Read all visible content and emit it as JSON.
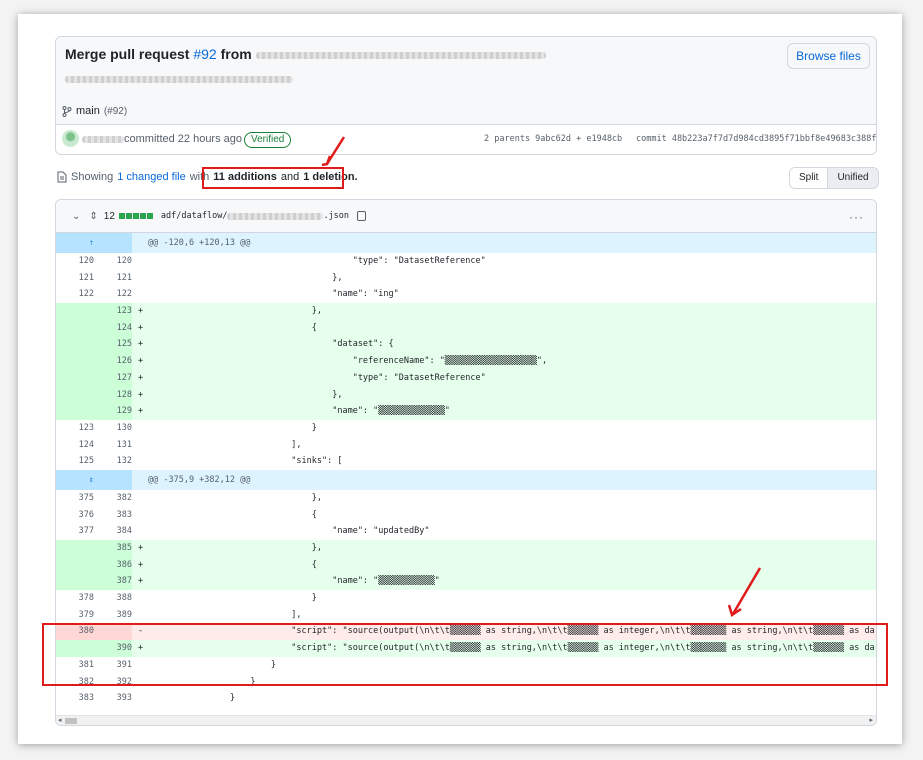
{
  "commit": {
    "title_prefix": "Merge pull request",
    "pr_link": "#92",
    "title_from": "from",
    "browse_label": "Browse files",
    "branch_name": "main",
    "branch_pr": "(#92)",
    "committed_text": "committed 22 hours ago",
    "verified_label": "Verified",
    "parents_text": "2 parents 9abc62d + e1948cb",
    "commit_sha": "commit 48b223a7f7d7d984cd3895f71bbf8e49683c388f"
  },
  "summary": {
    "showing": "Showing",
    "changed_file": "1 changed file",
    "with": "with",
    "additions": "11 additions",
    "and": "and",
    "deletions": "1 deletion."
  },
  "view_toggle": {
    "split": "Split",
    "unified": "Unified"
  },
  "file": {
    "change_count": "12",
    "path_prefix": "adf/dataflow/",
    "path_suffix": ".json",
    "more_label": "···"
  },
  "diff_rows": [
    {
      "type": "hunk",
      "text": "@@ -120,6 +120,13 @@"
    },
    {
      "type": "ctx",
      "o": "120",
      "n": "120",
      "code": "                                        \"type\": \"DatasetReference\""
    },
    {
      "type": "ctx",
      "o": "121",
      "n": "121",
      "code": "                                    },"
    },
    {
      "type": "ctx",
      "o": "122",
      "n": "122",
      "code": "                                    \"name\": \"ing\""
    },
    {
      "type": "add",
      "o": "",
      "n": "123",
      "code": "                                },"
    },
    {
      "type": "add",
      "o": "",
      "n": "124",
      "code": "                                {"
    },
    {
      "type": "add",
      "o": "",
      "n": "125",
      "code": "                                    \"dataset\": {"
    },
    {
      "type": "add",
      "o": "",
      "n": "126",
      "code": "                                        \"referenceName\": \"▒▒▒▒▒▒▒▒▒▒▒▒▒▒▒▒▒▒\","
    },
    {
      "type": "add",
      "o": "",
      "n": "127",
      "code": "                                        \"type\": \"DatasetReference\""
    },
    {
      "type": "add",
      "o": "",
      "n": "128",
      "code": "                                    },"
    },
    {
      "type": "add",
      "o": "",
      "n": "129",
      "code": "                                    \"name\": \"▒▒▒▒▒▒▒▒▒▒▒▒▒\""
    },
    {
      "type": "ctx",
      "o": "123",
      "n": "130",
      "code": "                                }"
    },
    {
      "type": "ctx",
      "o": "124",
      "n": "131",
      "code": "                            ],"
    },
    {
      "type": "ctx",
      "o": "125",
      "n": "132",
      "code": "                            \"sinks\": ["
    },
    {
      "type": "hunk",
      "text": "@@ -375,9 +382,12 @@"
    },
    {
      "type": "ctx",
      "o": "375",
      "n": "382",
      "code": "                                },"
    },
    {
      "type": "ctx",
      "o": "376",
      "n": "383",
      "code": "                                {"
    },
    {
      "type": "ctx",
      "o": "377",
      "n": "384",
      "code": "                                    \"name\": \"updatedBy\""
    },
    {
      "type": "add",
      "o": "",
      "n": "385",
      "code": "                                },"
    },
    {
      "type": "add",
      "o": "",
      "n": "386",
      "code": "                                {"
    },
    {
      "type": "add",
      "o": "",
      "n": "387",
      "code": "                                    \"name\": \"▒▒▒▒▒▒▒▒▒▒▒\""
    },
    {
      "type": "ctx",
      "o": "378",
      "n": "388",
      "code": "                                }"
    },
    {
      "type": "ctx",
      "o": "379",
      "n": "389",
      "code": "                            ],"
    },
    {
      "type": "del",
      "o": "380",
      "n": "",
      "code": "                            \"script\": \"source(output(\\n\\t\\t▒▒▒▒▒▒ as string,\\n\\t\\t▒▒▒▒▒▒ as integer,\\n\\t\\t▒▒▒▒▒▒▒ as string,\\n\\t\\t▒▒▒▒▒▒ as da"
    },
    {
      "type": "add",
      "o": "",
      "n": "390",
      "code": "                            \"script\": \"source(output(\\n\\t\\t▒▒▒▒▒▒ as string,\\n\\t\\t▒▒▒▒▒▒ as integer,\\n\\t\\t▒▒▒▒▒▒▒ as string,\\n\\t\\t▒▒▒▒▒▒ as da"
    },
    {
      "type": "ctx",
      "o": "381",
      "n": "391",
      "code": "                        }"
    },
    {
      "type": "ctx",
      "o": "382",
      "n": "392",
      "code": "                    }"
    },
    {
      "type": "ctx",
      "o": "383",
      "n": "393",
      "code": "                }"
    }
  ],
  "colors": {
    "annotation": "#e01b1b",
    "link": "#0969da",
    "add": "#e6ffec",
    "del": "#ffebe9"
  }
}
